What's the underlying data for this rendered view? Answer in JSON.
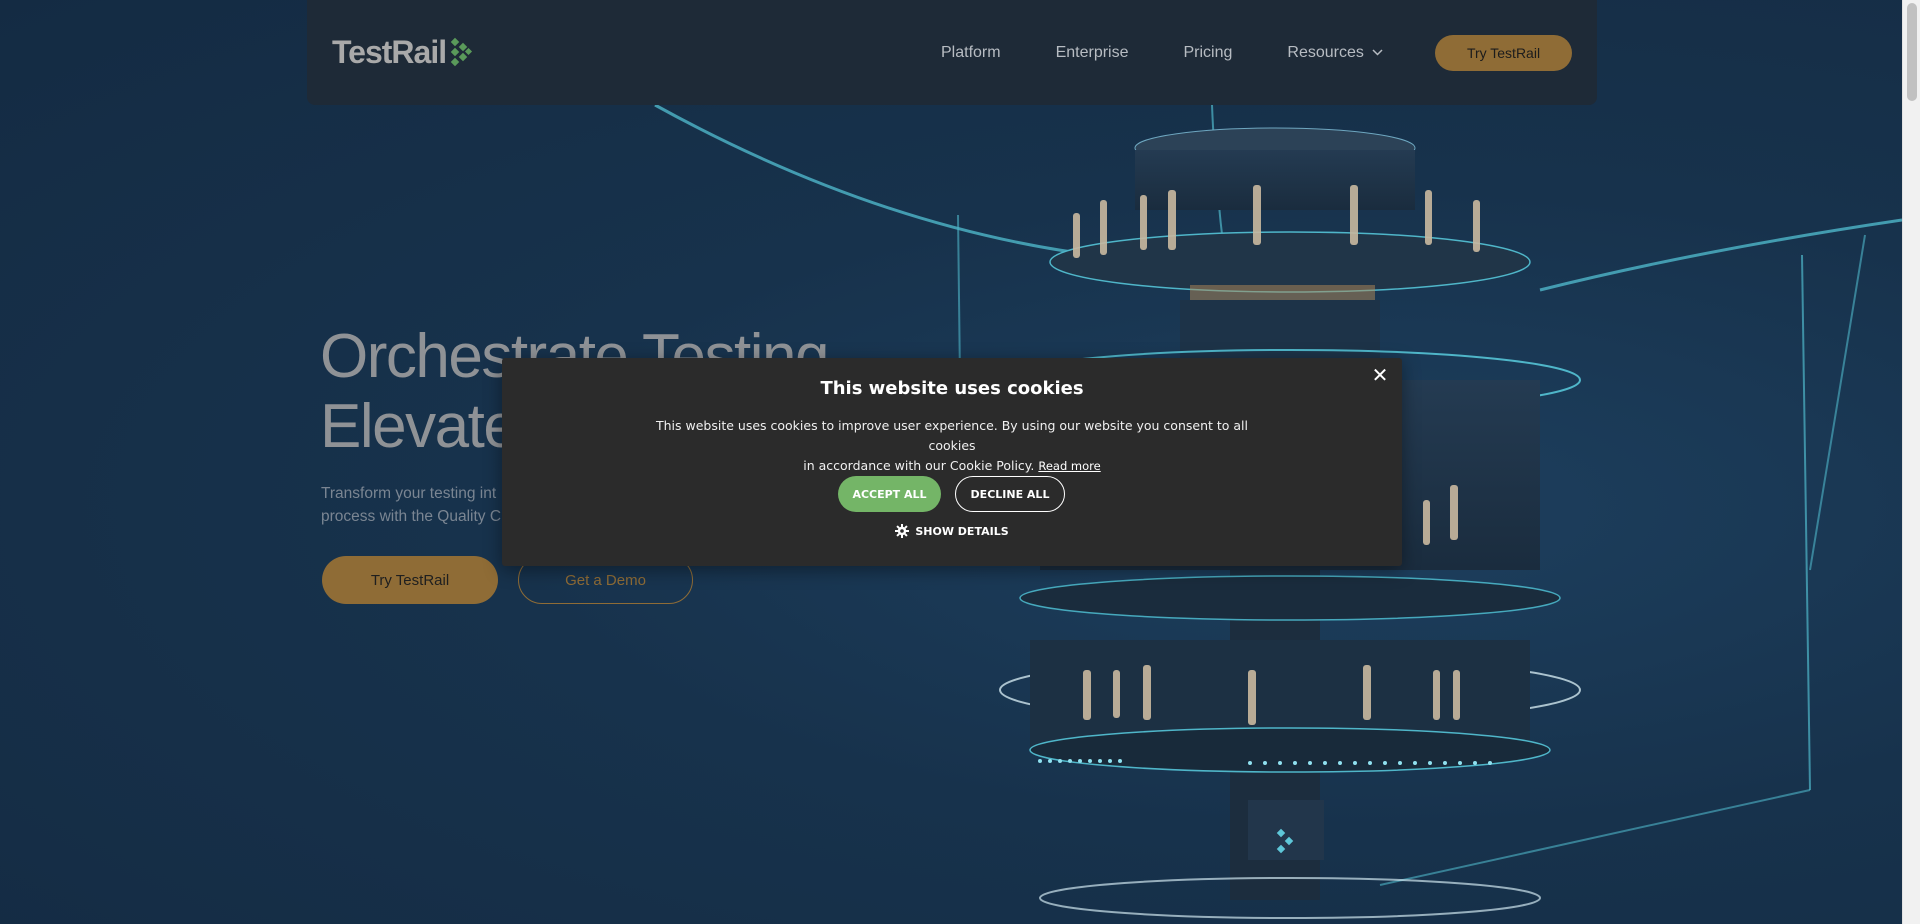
{
  "nav": {
    "logo_text": "TestRail",
    "links": [
      "Platform",
      "Enterprise",
      "Pricing",
      "Resources"
    ],
    "cta": "Try TestRail"
  },
  "hero": {
    "title_line1": "Orchestrate Testing",
    "title_line2": "Elevate",
    "subtitle_line1": "Transform your testing int",
    "subtitle_line2": "process with the Quality C",
    "primary_button": "Try TestRail",
    "secondary_button": "Get a Demo"
  },
  "cookie_modal": {
    "title": "This website uses cookies",
    "text_line1": "This website uses cookies to improve user experience. By using our website you consent to all cookies",
    "text_line2": "in accordance with our Cookie Policy.",
    "read_more": "Read more",
    "accept": "ACCEPT ALL",
    "decline": "DECLINE ALL",
    "show_details": "SHOW DETAILS",
    "close_symbol": "✕"
  },
  "colors": {
    "accent_gold": "#8f6c36",
    "accept_green": "#74b567",
    "logo_green": "#5a9a5a"
  }
}
